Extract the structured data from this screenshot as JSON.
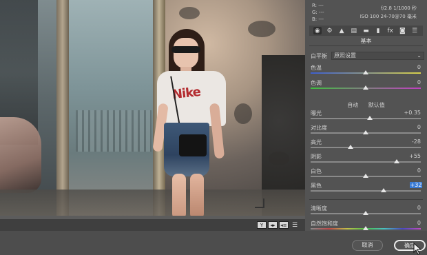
{
  "info": {
    "r_label": "R: ---",
    "g_label": "G: ---",
    "b_label": "B: ---",
    "camera_line1": "f/2.8  1/1000 秒",
    "camera_line2": "ISO 100  24-70@70 毫米"
  },
  "tabs": [
    {
      "name": "basic-tab-icon",
      "glyph": "◉"
    },
    {
      "name": "tone-curve-tab-icon",
      "glyph": "⚙"
    },
    {
      "name": "detail-tab-icon",
      "glyph": "▲"
    },
    {
      "name": "hsl-tab-icon",
      "glyph": "▤"
    },
    {
      "name": "split-toning-tab-icon",
      "glyph": "▬"
    },
    {
      "name": "lens-tab-icon",
      "glyph": "▮"
    },
    {
      "name": "effects-tab-icon",
      "glyph": "fx"
    },
    {
      "name": "calibration-tab-icon",
      "glyph": "◙"
    },
    {
      "name": "presets-tab-icon",
      "glyph": "☰"
    }
  ],
  "section_title": "基本",
  "white_balance": {
    "label": "白平衡",
    "value": "原照设置"
  },
  "sliders_top": [
    {
      "name": "色温",
      "value": "0",
      "level": 0.5
    },
    {
      "name": "色调",
      "value": "0",
      "level": 0.5
    }
  ],
  "auto_label": "自动",
  "default_label": "默认值",
  "sliders_main": [
    {
      "name": "曝光",
      "value": "+0.35",
      "level": 0.54
    },
    {
      "name": "对比度",
      "value": "0",
      "level": 0.5
    },
    {
      "name": "高光",
      "value": "-28",
      "level": 0.36
    },
    {
      "name": "阴影",
      "value": "+55",
      "level": 0.78
    },
    {
      "name": "白色",
      "value": "0",
      "level": 0.5
    },
    {
      "name": "黑色",
      "value": "+32",
      "level": 0.66,
      "highlight": true
    }
  ],
  "sliders_presence": [
    {
      "name": "清晰度",
      "value": "0",
      "level": 0.5
    },
    {
      "name": "自然饱和度",
      "value": "0",
      "level": 0.5
    }
  ],
  "viewbar": {
    "y_label": "Y",
    "swap_label": "◂▸",
    "copy_label": "◂≡",
    "settings_icon": "☰"
  },
  "footer": {
    "cancel_label": "取消",
    "ok_label": "确定"
  },
  "shirt_text": "Nike",
  "colors": {
    "accent": "#3a7bd5",
    "panel": "#535353",
    "background": "#3c3c3c"
  }
}
